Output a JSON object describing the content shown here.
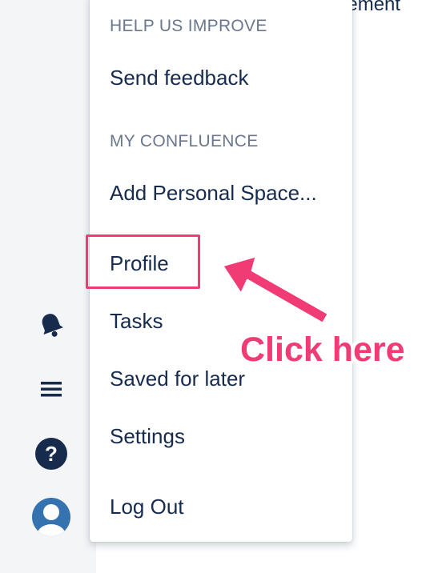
{
  "background": {
    "partial_text": "gement"
  },
  "sidebar": {
    "icons": [
      "bell-icon",
      "menu-icon",
      "help-icon",
      "avatar-icon"
    ]
  },
  "menu": {
    "sections": [
      {
        "heading": "HELP US IMPROVE",
        "items": [
          "Send feedback"
        ]
      },
      {
        "heading": "MY CONFLUENCE",
        "items": [
          "Add Personal Space...",
          "Profile",
          "Tasks",
          "Saved for later",
          "Settings",
          "Log Out"
        ]
      }
    ]
  },
  "annotation": {
    "callout_text": "Click here",
    "highlight_target": "Profile",
    "color": "#f03b74"
  },
  "colors": {
    "text_primary": "#172b4d",
    "text_heading": "#6b778c",
    "sidebar_bg": "#f4f5f7",
    "avatar_blue": "#3572b0"
  }
}
